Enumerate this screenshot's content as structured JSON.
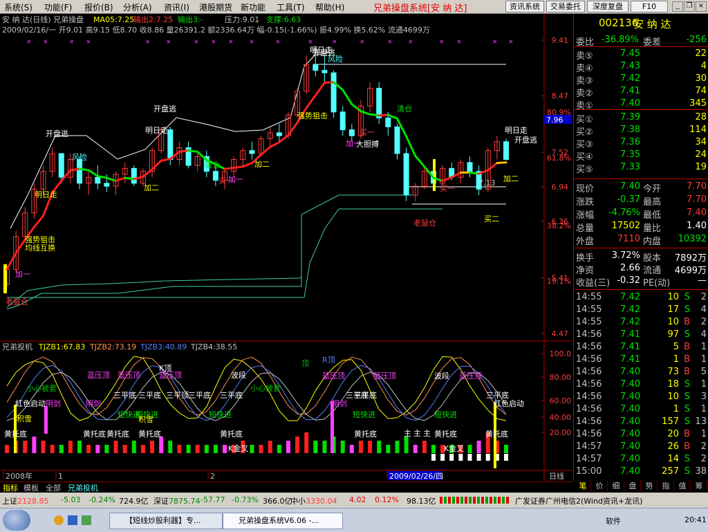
{
  "menu": {
    "items": [
      "系统(S)",
      "功能(F)",
      "报价(B)",
      "分析(A)",
      "资讯(I)",
      "港股期货",
      "新功能",
      "工具(T)",
      "帮助(H)"
    ],
    "app_title": "兄弟操盘系统[安 纳 达]",
    "buttons": [
      "资讯系统",
      "交易委托",
      "深度复盘",
      "F10"
    ]
  },
  "header": {
    "line1_stock": "安 纳 达(日线) 兄弟操盘",
    "ma": "MA05:7.25",
    "sell_out": "输出2:7.25",
    "out3": "输出3:-",
    "pressure": "压力:9.01",
    "support": "支撑:6.63",
    "line2": "2009/02/16/一 开9.01 高9.15 低8.70 收8.86 量26391.2 额2336.64万 幅-0.15(-1.66%) 振4.99% 换5.62% 流通4699万"
  },
  "indicator": {
    "name": "兄弟投机",
    "tj1": "TJZB1:67.83",
    "tj2": "TJZB2:73.19",
    "tj3": "TJZB3:40.89",
    "tj4": "TJZB4:38.55"
  },
  "colors": {
    "up": "#ff3c3c",
    "down": "#54ffff",
    "ma_up": "#ff2020",
    "ma_mid": "#ffc000",
    "ma_down": "#00e000"
  },
  "chart_data": {
    "type": "candlestick",
    "price_axis": [
      "9.41",
      "8.47",
      "7.52",
      "6.94",
      "6.36",
      "5.41",
      "4.47"
    ],
    "pct_axis": [
      "80.9%",
      "61.8%",
      "38.2%",
      "19.1%"
    ],
    "ind_axis": [
      "100.0",
      "80.00",
      "60.00",
      "40.00",
      "20.00"
    ],
    "last_marker": "7.96",
    "date_axis": [
      "2008年",
      "1",
      "2",
      "2009/02/26/四",
      "日线"
    ],
    "ohlc": [
      [
        5.3,
        5.6,
        5.25,
        5.55
      ],
      [
        5.55,
        6.2,
        5.5,
        6.1
      ],
      [
        6.1,
        6.6,
        6.0,
        6.5
      ],
      [
        6.5,
        7.0,
        6.4,
        6.9
      ],
      [
        6.9,
        7.3,
        6.8,
        7.2
      ],
      [
        7.2,
        7.6,
        7.1,
        7.5
      ],
      [
        7.5,
        7.4,
        7.0,
        7.1
      ],
      [
        7.1,
        7.5,
        7.0,
        7.4
      ],
      [
        7.4,
        7.45,
        6.9,
        7.0
      ],
      [
        7.0,
        7.2,
        6.8,
        7.1
      ],
      [
        7.1,
        7.3,
        6.9,
        7.0
      ],
      [
        7.0,
        7.15,
        6.85,
        6.95
      ],
      [
        6.95,
        7.2,
        6.8,
        7.15
      ],
      [
        7.15,
        7.35,
        7.0,
        7.25
      ],
      [
        7.25,
        7.3,
        6.95,
        7.0
      ],
      [
        7.0,
        7.25,
        6.95,
        7.2
      ],
      [
        7.2,
        7.6,
        7.1,
        7.55
      ],
      [
        7.55,
        7.95,
        7.5,
        7.9
      ],
      [
        7.9,
        7.95,
        7.3,
        7.4
      ],
      [
        7.4,
        7.7,
        7.3,
        7.6
      ],
      [
        7.6,
        7.7,
        7.25,
        7.3
      ],
      [
        7.3,
        7.5,
        7.2,
        7.45
      ],
      [
        7.45,
        7.55,
        7.1,
        7.2
      ],
      [
        7.2,
        7.3,
        6.95,
        7.05
      ],
      [
        7.05,
        7.25,
        6.9,
        7.2
      ],
      [
        7.2,
        7.45,
        7.1,
        7.4
      ],
      [
        7.4,
        7.6,
        7.3,
        7.55
      ],
      [
        7.55,
        7.7,
        7.4,
        7.5
      ],
      [
        7.5,
        7.8,
        7.45,
        7.75
      ],
      [
        7.75,
        7.95,
        7.6,
        7.85
      ],
      [
        7.85,
        8.0,
        7.7,
        7.8
      ],
      [
        7.8,
        8.2,
        7.75,
        8.15
      ],
      [
        8.15,
        8.6,
        8.1,
        8.55
      ],
      [
        8.55,
        9.15,
        8.5,
        9.0
      ],
      [
        9.0,
        9.3,
        8.8,
        8.9
      ],
      [
        8.9,
        9.15,
        8.7,
        8.86
      ],
      [
        8.86,
        8.9,
        8.1,
        8.2
      ],
      [
        8.2,
        8.3,
        7.8,
        7.9
      ],
      [
        7.9,
        8.0,
        7.7,
        7.8
      ],
      [
        7.8,
        8.4,
        7.75,
        8.3
      ],
      [
        8.3,
        8.7,
        8.2,
        8.6
      ],
      [
        8.6,
        8.7,
        8.0,
        8.1
      ],
      [
        8.1,
        8.2,
        7.8,
        7.95
      ],
      [
        7.95,
        8.0,
        7.4,
        7.5
      ],
      [
        7.5,
        7.6,
        6.7,
        6.8
      ],
      [
        6.8,
        7.0,
        6.7,
        6.95
      ],
      [
        6.95,
        7.3,
        6.9,
        7.2
      ],
      [
        7.2,
        7.35,
        6.95,
        7.0
      ],
      [
        7.0,
        7.3,
        6.95,
        7.25
      ],
      [
        7.25,
        7.35,
        7.05,
        7.1
      ],
      [
        7.1,
        7.4,
        7.0,
        7.35
      ],
      [
        7.35,
        7.45,
        7.1,
        7.2
      ],
      [
        7.2,
        7.3,
        6.8,
        6.9
      ],
      [
        6.9,
        7.6,
        6.85,
        7.55
      ],
      [
        7.55,
        7.8,
        7.4,
        7.7
      ],
      [
        7.7,
        7.75,
        7.38,
        7.4
      ]
    ],
    "bars": [
      2,
      3,
      3,
      4,
      3,
      2,
      -2,
      3,
      -3,
      2,
      -2,
      -2,
      3,
      2,
      -3,
      2,
      3,
      4,
      -3,
      2,
      -2,
      2,
      -2,
      -2,
      2,
      2,
      3,
      -2,
      2,
      3,
      -2,
      3,
      4,
      5,
      -3,
      -3,
      -4,
      -3,
      -2,
      3,
      3,
      -3,
      -2,
      -3,
      -4,
      -2,
      3,
      -2,
      2,
      -2,
      2,
      -2,
      -3,
      5,
      3,
      -2
    ],
    "annotations": [
      "老鼠仓",
      "加一",
      "强势狙击",
      "均线互换",
      "明日走",
      "开盘逃",
      "风险",
      "加二",
      "明日走",
      "开盘逃",
      "清仓",
      "买一",
      "加一",
      "加二",
      "强势狙击",
      "明日走",
      "开盘逃",
      "风险",
      "加一",
      "买一",
      "大胆搏",
      "清仓",
      "老鼠仓",
      "买一",
      "加二",
      "7.13",
      "明日走",
      "开盘逃",
      "买二"
    ],
    "ind_annotations": [
      "小心被套",
      "蓝压顶",
      "蓝压顶",
      "蓝压顶",
      "波段",
      "小心被套",
      "顶",
      "R顶",
      "蓝压顶",
      "蓝压顶",
      "波段",
      "蓝压顶",
      "三平底",
      "三平底",
      "三平顶",
      "三平底",
      "三平底",
      "三平底",
      "三平底",
      "三平底",
      "红色启动",
      "阴剑",
      "阴剑",
      "阴剑",
      "短快进",
      "短快进",
      "短快进",
      "短快进",
      "短快进",
      "积雪",
      "积雪",
      "黄托底",
      "黄托底",
      "黄托底",
      "黄托底",
      "黄托底",
      "黄托底",
      "黄托底",
      "黄托底",
      "主",
      "主",
      "主",
      "K金叉",
      "K金叉",
      "红色启动",
      "K顶"
    ]
  },
  "quote": {
    "code": "002136",
    "name": "安 纳 达",
    "wei_bi_label": "委比",
    "wei_bi": "-36.89%",
    "wei_cha_label": "委差",
    "wei_cha": "-256",
    "sell": [
      {
        "l": "卖⑤",
        "p": "7.45",
        "v": "22"
      },
      {
        "l": "卖④",
        "p": "7.43",
        "v": "4"
      },
      {
        "l": "卖③",
        "p": "7.42",
        "v": "30"
      },
      {
        "l": "卖②",
        "p": "7.41",
        "v": "74"
      },
      {
        "l": "卖①",
        "p": "7.40",
        "v": "345"
      }
    ],
    "buy": [
      {
        "l": "买①",
        "p": "7.39",
        "v": "28"
      },
      {
        "l": "买②",
        "p": "7.38",
        "v": "114"
      },
      {
        "l": "买③",
        "p": "7.36",
        "v": "34"
      },
      {
        "l": "买④",
        "p": "7.35",
        "v": "24"
      },
      {
        "l": "买⑤",
        "p": "7.33",
        "v": "19"
      }
    ],
    "stats": [
      [
        "现价",
        "7.40",
        "今开",
        "7.70"
      ],
      [
        "涨跌",
        "-0.37",
        "最高",
        "7.70"
      ],
      [
        "涨幅",
        "-4.76%",
        "最低",
        "7.40"
      ],
      [
        "总量",
        "17502",
        "量比",
        "1.40"
      ],
      [
        "外盘",
        "7110",
        "内盘",
        "10392"
      ]
    ],
    "stats2": [
      [
        "换手",
        "3.72%",
        "股本",
        "7892万"
      ],
      [
        "净资",
        "2.66",
        "流通",
        "4699万"
      ],
      [
        "收益(三)",
        "-0.32",
        "PE(动)",
        "—"
      ]
    ],
    "ticks": [
      [
        "14:55",
        "7.42",
        "10",
        "S",
        "2"
      ],
      [
        "14:55",
        "7.42",
        "17",
        "S",
        "4"
      ],
      [
        "14:55",
        "7.42",
        "10",
        "B",
        "2"
      ],
      [
        "14:56",
        "7.41",
        "97",
        "S",
        "4"
      ],
      [
        "14:56",
        "7.41",
        "5",
        "B",
        "1"
      ],
      [
        "14:56",
        "7.41",
        "1",
        "B",
        "1"
      ],
      [
        "14:56",
        "7.40",
        "73",
        "B",
        "5"
      ],
      [
        "14:56",
        "7.40",
        "18",
        "S",
        "1"
      ],
      [
        "14:56",
        "7.40",
        "10",
        "S",
        "3"
      ],
      [
        "14:56",
        "7.40",
        "1",
        "S",
        "1"
      ],
      [
        "14:56",
        "7.40",
        "157",
        "S",
        "13"
      ],
      [
        "14:56",
        "7.40",
        "20",
        "B",
        "1"
      ],
      [
        "14:57",
        "7.40",
        "26",
        "B",
        "2"
      ],
      [
        "14:57",
        "7.40",
        "14",
        "S",
        "2"
      ],
      [
        "15:00",
        "7.40",
        "257",
        "S",
        "38"
      ]
    ],
    "tabs": [
      "笔",
      "价",
      "细",
      "盘",
      "势",
      "指",
      "值",
      "筹"
    ]
  },
  "bottom_tabs": [
    "指标",
    "模板",
    "全部",
    "兄弟投机"
  ],
  "status": {
    "sh_label": "上证",
    "sh": "2128.85",
    "sh_chg": "-5.03",
    "sh_pct": "-0.24%",
    "sh_amt": "724.9亿",
    "sz_label": "深证",
    "sz": "7875.74",
    "sz_chg": "-57.77",
    "sz_pct": "-0.73%",
    "sz_amt": "366.0亿",
    "zx_label": "中小",
    "zx": "3330.04",
    "zx_chg": "4.02",
    "zx_pct": "0.12%",
    "zx_amt": "98.13亿",
    "broker": "广发证券广州电信2(Wind资讯+龙讯)"
  },
  "taskbar": {
    "tasks": [
      "【短线炒股利器】专...",
      "兄弟操盘系统V6.06 -..."
    ],
    "soft": "软件",
    "time": "20:41"
  }
}
